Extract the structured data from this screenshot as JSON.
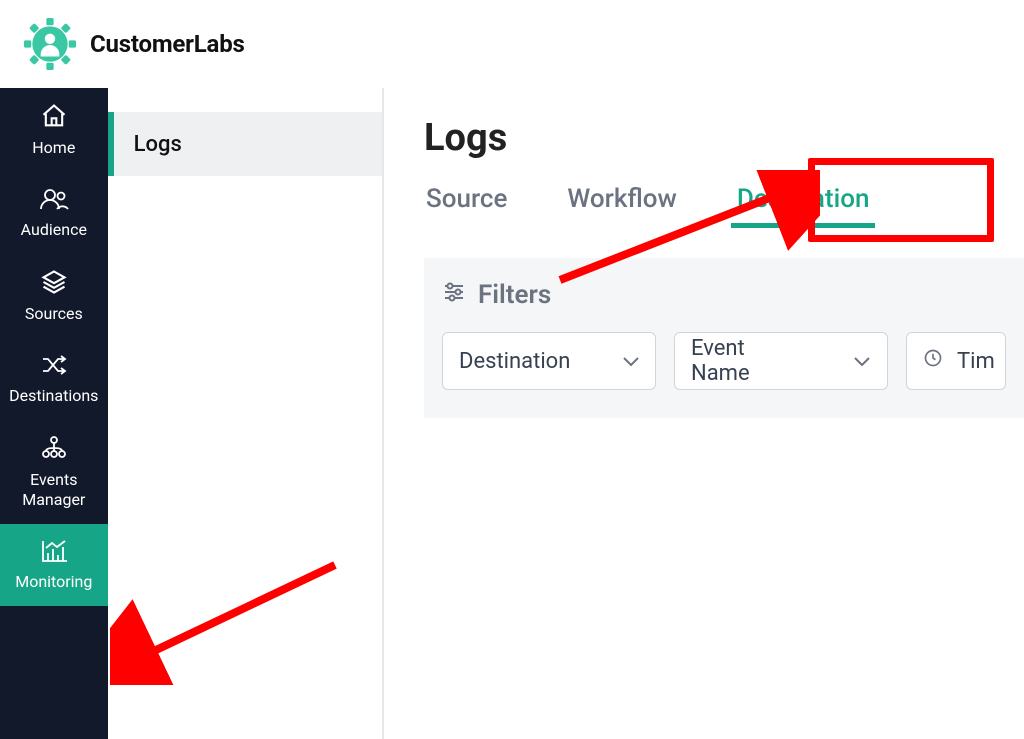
{
  "brand": {
    "name": "CustomerLabs"
  },
  "sidebar": {
    "items": [
      {
        "label": "Home"
      },
      {
        "label": "Audience"
      },
      {
        "label": "Sources"
      },
      {
        "label": "Destinations"
      },
      {
        "label": "Events Manager"
      },
      {
        "label": "Monitoring"
      }
    ]
  },
  "subnav": {
    "items": [
      {
        "label": "Logs"
      }
    ]
  },
  "page": {
    "title": "Logs"
  },
  "tabs": [
    {
      "label": "Source"
    },
    {
      "label": "Workflow"
    },
    {
      "label": "Destination"
    }
  ],
  "filters": {
    "heading": "Filters",
    "destination": {
      "label": "Destination"
    },
    "event_name": {
      "label": "Event Name"
    },
    "time": {
      "label": "Tim"
    }
  }
}
